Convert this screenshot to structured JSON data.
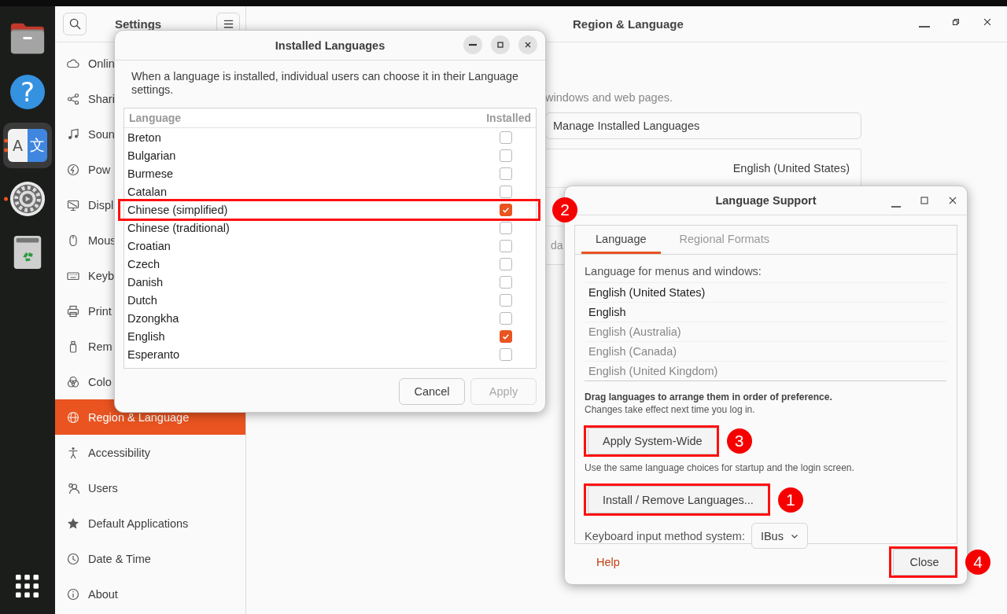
{
  "dock": {
    "items": [
      {
        "kind": "files",
        "running": false,
        "focused": false
      },
      {
        "kind": "help",
        "running": false,
        "focused": false,
        "glyphs": [
          "?"
        ]
      },
      {
        "kind": "language",
        "running": true,
        "focused": true,
        "multiple_windows": true,
        "glyphs": [
          "A",
          "文"
        ]
      },
      {
        "kind": "settings",
        "running": true,
        "focused": false,
        "multiple_windows": false
      },
      {
        "kind": "trash",
        "running": false,
        "focused": false
      }
    ]
  },
  "settings": {
    "sidebar_title": "Settings",
    "page_title": "Region & Language",
    "sidebar": [
      {
        "label": "Onlin",
        "kind": "cloud",
        "selected": false
      },
      {
        "label": "Shari",
        "kind": "share",
        "selected": false
      },
      {
        "label": "Soun",
        "kind": "note",
        "selected": false
      },
      {
        "label": "Pow",
        "kind": "bolt",
        "selected": false
      },
      {
        "label": "Displ",
        "kind": "display",
        "selected": false
      },
      {
        "label": "Mous",
        "kind": "mouse",
        "selected": false
      },
      {
        "label": "Keyb",
        "kind": "keyboard",
        "selected": false
      },
      {
        "label": "Print",
        "kind": "printer",
        "selected": false
      },
      {
        "label": "Rem",
        "kind": "drive",
        "selected": false
      },
      {
        "label": "Colo",
        "kind": "color",
        "selected": false
      },
      {
        "label": "Region & Language",
        "kind": "globe",
        "selected": true
      },
      {
        "label": "Accessibility",
        "kind": "person",
        "selected": false
      },
      {
        "label": "Users",
        "kind": "users",
        "selected": false
      },
      {
        "label": "Default Applications",
        "kind": "star",
        "selected": false
      },
      {
        "label": "Date & Time",
        "kind": "clock",
        "selected": false
      },
      {
        "label": "About",
        "kind": "info",
        "selected": false
      }
    ],
    "description": "windows and web pages.",
    "manage_button": "Manage Installed Languages",
    "language_value": "English (United States)",
    "row_fragment": "da"
  },
  "installed_dialog": {
    "title": "Installed Languages",
    "intro": "When a language is installed, individual users can choose it in their Language settings.",
    "columns": [
      "Language",
      "Installed"
    ],
    "rows": [
      {
        "name": "Breton",
        "installed": false,
        "highlighted": false
      },
      {
        "name": "Bulgarian",
        "installed": false,
        "highlighted": false
      },
      {
        "name": "Burmese",
        "installed": false,
        "highlighted": false
      },
      {
        "name": "Catalan",
        "installed": false,
        "highlighted": false
      },
      {
        "name": "Chinese (simplified)",
        "installed": true,
        "highlighted": true,
        "marker": "2"
      },
      {
        "name": "Chinese (traditional)",
        "installed": false,
        "highlighted": false
      },
      {
        "name": "Croatian",
        "installed": false,
        "highlighted": false
      },
      {
        "name": "Czech",
        "installed": false,
        "highlighted": false
      },
      {
        "name": "Danish",
        "installed": false,
        "highlighted": false
      },
      {
        "name": "Dutch",
        "installed": false,
        "highlighted": false
      },
      {
        "name": "Dzongkha",
        "installed": false,
        "highlighted": false
      },
      {
        "name": "English",
        "installed": true,
        "highlighted": false
      },
      {
        "name": "Esperanto",
        "installed": false,
        "highlighted": false
      }
    ],
    "buttons": [
      {
        "label": "Cancel",
        "disabled": false
      },
      {
        "label": "Apply",
        "disabled": true
      }
    ]
  },
  "language_support": {
    "title": "Language Support",
    "tabs": [
      {
        "label": "Language",
        "selected": true
      },
      {
        "label": "Regional Formats",
        "selected": false
      }
    ],
    "list_label": "Language for menus and windows:",
    "languages": [
      {
        "name": "English (United States)",
        "in_use": true
      },
      {
        "name": "English",
        "in_use": true
      },
      {
        "name": "English (Australia)",
        "in_use": false
      },
      {
        "name": "English (Canada)",
        "in_use": false
      },
      {
        "name": "English (United Kingdom)",
        "in_use": false
      }
    ],
    "drag_hint": "Drag languages to arrange them in order of preference.",
    "drag_note": "Changes take effect next time you log in.",
    "apply_button": {
      "label": "Apply System-Wide",
      "highlighted": true,
      "marker": "3"
    },
    "apply_note": "Use the same language choices for startup and the login screen.",
    "install_button": {
      "label": "Install / Remove Languages...",
      "highlighted": true,
      "marker": "1"
    },
    "input_label": "Keyboard input method system:",
    "input_value": "IBus",
    "help_link": "Help",
    "close_button": {
      "label": "Close",
      "highlighted": true,
      "marker": "4"
    }
  }
}
